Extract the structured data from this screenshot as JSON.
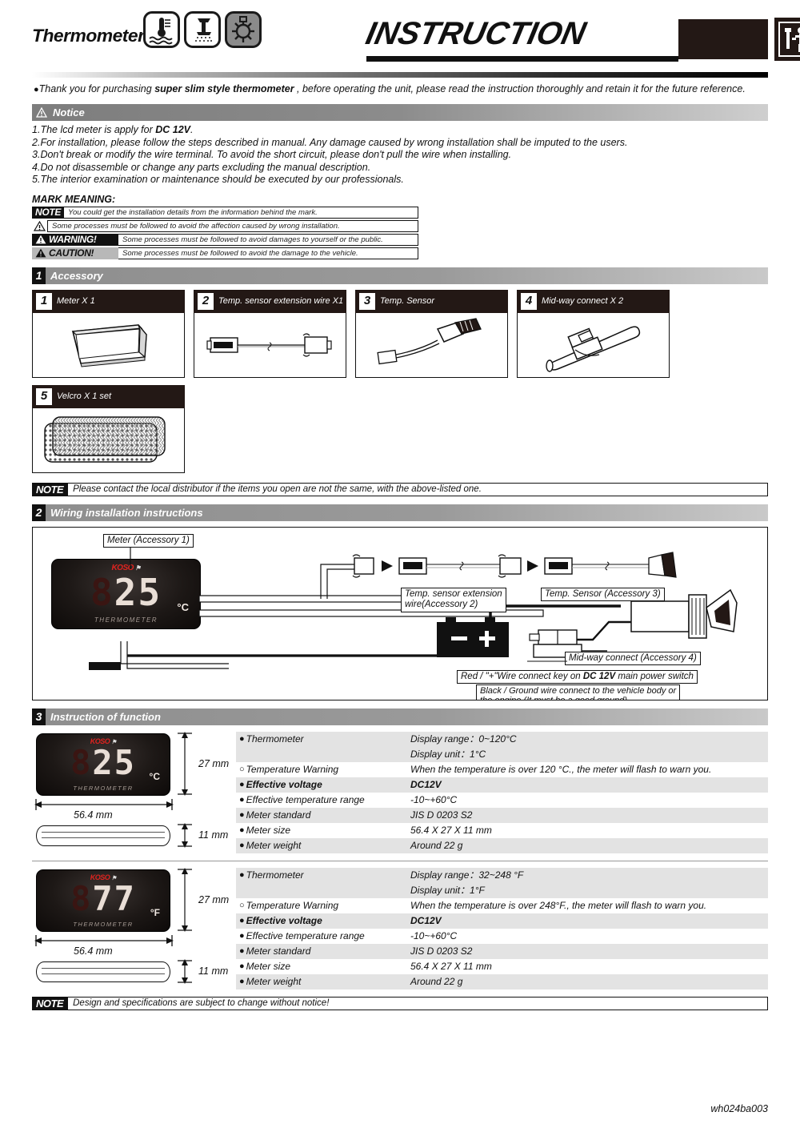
{
  "header": {
    "brand_word": "Thermometer",
    "title": "INSTRUCTION",
    "icons": [
      "water-thermometer-icon",
      "shower-icon",
      "sun-icon"
    ],
    "worker_icon": "worker-with-wrench-icon"
  },
  "intro": {
    "bullet": "●",
    "text_a": "Thank you for purchasing ",
    "text_b": "super slim style thermometer",
    "text_c": " , before operating the unit, please read the instruction thoroughly and retain it for the future reference."
  },
  "notice": {
    "bar_label": "Notice",
    "items": [
      {
        "num": "1.",
        "text_a": "The lcd meter is apply for ",
        "bold": "DC 12V",
        "text_b": "."
      },
      {
        "num": "2.",
        "text_a": "For installation, please follow the steps described in manual. Any damage caused by wrong installation shall be imputed to the users.",
        "bold": "",
        "text_b": ""
      },
      {
        "num": "3.",
        "text_a": "Don't break or modify the wire terminal. To avoid the short circuit, please don't pull the wire when installing.",
        "bold": "",
        "text_b": ""
      },
      {
        "num": "4.",
        "text_a": "Do not disassemble or change any parts excluding the manual description.",
        "bold": "",
        "text_b": ""
      },
      {
        "num": "5.",
        "text_a": "The interior examination or maintenance should be executed by our professionals.",
        "bold": "",
        "text_b": ""
      }
    ]
  },
  "mark_meaning": {
    "title": "MARK MEANING:",
    "rows": [
      {
        "badge": "NOTE",
        "style": "note",
        "text": "You could get the installation details from the information behind the mark."
      },
      {
        "badge": "",
        "style": "tri",
        "text": "Some processes must be followed to avoid the affection caused by wrong installation."
      },
      {
        "badge": "WARNING!",
        "style": "warning",
        "text": "Some processes must be followed to avoid damages to yourself or the public."
      },
      {
        "badge": "CAUTION!",
        "style": "caution",
        "text": "Some processes must be followed to avoid the damage to the vehicle."
      }
    ]
  },
  "accessory": {
    "section_num": "1",
    "section_label": "Accessory",
    "items": [
      {
        "num": "1",
        "label": "Meter X 1",
        "art": "meter-3d-icon"
      },
      {
        "num": "2",
        "label": "Temp. sensor extension wire X1",
        "art": "extension-wire-icon"
      },
      {
        "num": "3",
        "label": "Temp. Sensor",
        "art": "temp-sensor-icon"
      },
      {
        "num": "4",
        "label": "Mid-way connect X 2",
        "art": "midway-connector-icon"
      },
      {
        "num": "5",
        "label": "Velcro X 1 set",
        "art": "velcro-pad-icon"
      }
    ],
    "note_badge": "NOTE",
    "note_text": "Please contact the local distributor if the items you open are not the same, with the above-listed one."
  },
  "wiring": {
    "section_num": "2",
    "section_label": "Wiring installation instructions",
    "callouts": {
      "meter": "Meter (Accessory 1)",
      "extension_wire": "Temp. sensor extension\nwire(Accessory 2)",
      "temp_sensor": "Temp. Sensor (Accessory 3)",
      "midway": "Mid-way connect (Accessory 4)",
      "red_wire_a": "Red / \"+\"Wire connect key on ",
      "red_wire_bold": "DC 12V",
      "red_wire_b": " main power switch",
      "black_wire": "Black / Ground wire connect to the vehicle body or\nthe engine (It must be a good ground)"
    },
    "meter_display": {
      "brand": "KOSO",
      "ghost_digit": "8",
      "value": "25",
      "unit": "°C",
      "label": "THERMOMETER"
    },
    "battery": {
      "minus": "−",
      "plus": "+"
    }
  },
  "function": {
    "section_num": "3",
    "section_label": "Instruction of function",
    "blocks": [
      {
        "meter": {
          "brand": "KOSO",
          "ghost_digit": "8",
          "value": "25",
          "unit": "°C",
          "label": "THERMOMETER"
        },
        "dims": {
          "height": "27 mm",
          "width": "56.4 mm",
          "depth": "11 mm"
        },
        "rows": [
          {
            "label": "Thermometer",
            "marker": "filled",
            "value": "Display range：0~120°C",
            "value2": "Display unit：1°C",
            "shade": true,
            "bold": false
          },
          {
            "label": "Temperature Warning",
            "marker": "hollow",
            "value": "When the temperature is over 120 °C., the meter will flash to warn you.",
            "value2": "",
            "shade": false,
            "bold": false
          },
          {
            "label": "Effective voltage",
            "marker": "filled",
            "value": "DC12V",
            "value2": "",
            "shade": true,
            "bold": true
          },
          {
            "label": "Effective temperature range",
            "marker": "filled",
            "value": "-10~+60°C",
            "value2": "",
            "shade": false,
            "bold": false
          },
          {
            "label": "Meter standard",
            "marker": "filled",
            "value": "JIS D 0203 S2",
            "value2": "",
            "shade": true,
            "bold": false
          },
          {
            "label": "Meter size",
            "marker": "filled",
            "value": "56.4 X 27 X 11 mm",
            "value2": "",
            "shade": false,
            "bold": false
          },
          {
            "label": "Meter weight",
            "marker": "filled",
            "value": "Around 22 g",
            "value2": "",
            "shade": true,
            "bold": false
          }
        ]
      },
      {
        "meter": {
          "brand": "KOSO",
          "ghost_digit": "8",
          "value": "77",
          "unit": "°F",
          "label": "THERMOMETER"
        },
        "dims": {
          "height": "27 mm",
          "width": "56.4 mm",
          "depth": "11 mm"
        },
        "rows": [
          {
            "label": "Thermometer",
            "marker": "filled",
            "value": "Display range：32~248 °F",
            "value2": "Display unit：1°F",
            "shade": true,
            "bold": false
          },
          {
            "label": "Temperature Warning",
            "marker": "hollow",
            "value": "When the temperature is over 248°F., the meter will flash to warn you.",
            "value2": "",
            "shade": false,
            "bold": false
          },
          {
            "label": "Effective voltage",
            "marker": "filled",
            "value": "DC12V",
            "value2": "",
            "shade": true,
            "bold": true
          },
          {
            "label": "Effective temperature range",
            "marker": "filled",
            "value": "-10~+60°C",
            "value2": "",
            "shade": false,
            "bold": false
          },
          {
            "label": "Meter standard",
            "marker": "filled",
            "value": "JIS D 0203 S2",
            "value2": "",
            "shade": true,
            "bold": false
          },
          {
            "label": "Meter size",
            "marker": "filled",
            "value": "56.4 X 27 X 11 mm",
            "value2": "",
            "shade": false,
            "bold": false
          },
          {
            "label": "Meter weight",
            "marker": "filled",
            "value": "Around 22 g",
            "value2": "",
            "shade": true,
            "bold": false
          }
        ]
      }
    ]
  },
  "footer": {
    "note_badge": "NOTE",
    "note_text": "Design and specifications are subject to change without notice!",
    "code": "wh024ba003"
  },
  "colors": {
    "accent_red": "#e0231f",
    "bar_dark": "#8e8e8e",
    "ink": "#111111",
    "shade": "#e3e3e3"
  }
}
